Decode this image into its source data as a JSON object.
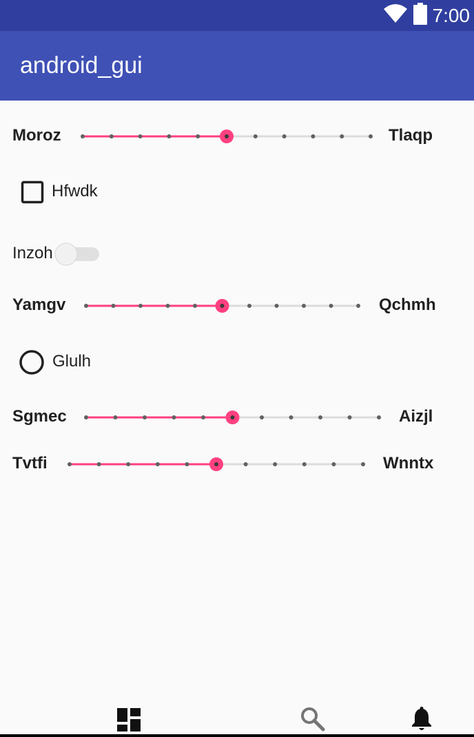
{
  "status_bar": {
    "time": "7:00",
    "icons": [
      "wifi-icon",
      "battery-icon"
    ]
  },
  "app_bar": {
    "title": "android_gui"
  },
  "controls": {
    "slider1": {
      "left_label": "Moroz",
      "right_label": "Tlaqp",
      "steps": 10,
      "value": 5
    },
    "checkbox": {
      "label": "Hfwdk",
      "checked": false
    },
    "switch": {
      "label": "Inzoh",
      "on": false
    },
    "slider2": {
      "left_label": "Yamgv",
      "right_label": "Qchmh",
      "steps": 10,
      "value": 5
    },
    "radio": {
      "label": "Glulh",
      "checked": false
    },
    "slider3": {
      "left_label": "Sgmec",
      "right_label": "Aizjl",
      "steps": 10,
      "value": 5
    },
    "slider4": {
      "left_label": "Tvtfi",
      "right_label": "Wnntx",
      "steps": 10,
      "value": 5
    }
  },
  "bottom_nav": {
    "items": [
      "dashboard-icon",
      "search-icon",
      "notifications-icon"
    ]
  },
  "colors": {
    "accent": "#ff4081",
    "primary": "#3f51b5",
    "primary_dark": "#303f9f"
  }
}
